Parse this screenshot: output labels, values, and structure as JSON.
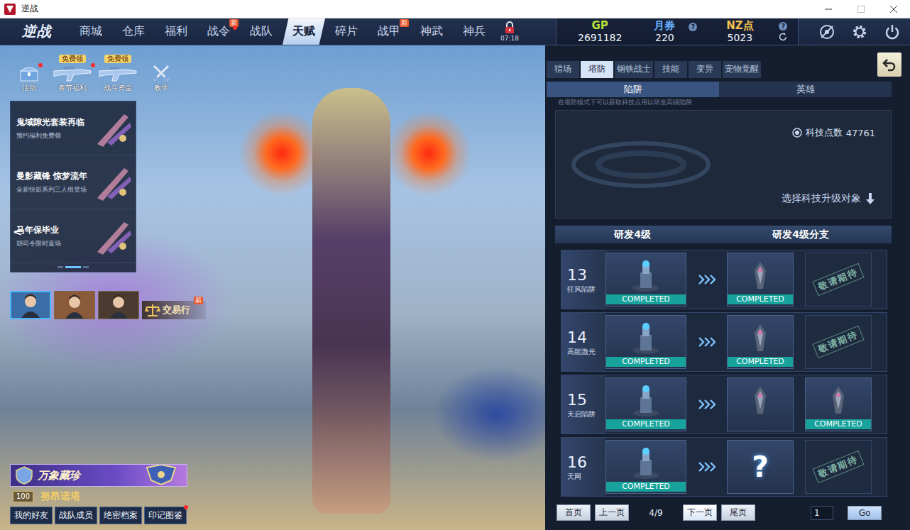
{
  "window": {
    "title": "逆战"
  },
  "nav": {
    "logo": "逆战",
    "lock_time": "07:18",
    "items": [
      {
        "label": "商城",
        "selected": false,
        "badge": "",
        "dot": false
      },
      {
        "label": "仓库",
        "selected": false,
        "badge": "",
        "dot": false
      },
      {
        "label": "福利",
        "selected": false,
        "badge": "",
        "dot": false
      },
      {
        "label": "战令",
        "selected": false,
        "badge": "新",
        "dot": true
      },
      {
        "label": "战队",
        "selected": false,
        "badge": "",
        "dot": false
      },
      {
        "label": "天赋",
        "selected": true,
        "badge": "",
        "dot": false
      },
      {
        "label": "碎片",
        "selected": false,
        "badge": "",
        "dot": false
      },
      {
        "label": "战甲",
        "selected": false,
        "badge": "新",
        "dot": false
      },
      {
        "label": "神武",
        "selected": false,
        "badge": "",
        "dot": false
      },
      {
        "label": "神兵",
        "selected": false,
        "badge": "",
        "dot": false
      }
    ]
  },
  "currencies": [
    {
      "label": "GP",
      "value": "2691182",
      "help": "",
      "refresh": false,
      "color": "#b5e03c"
    },
    {
      "label": "月券",
      "value": "220",
      "help": "?",
      "refresh": false,
      "color": "#6ab4ff"
    },
    {
      "label": "NZ点",
      "value": "5023",
      "help": "?",
      "refresh": true,
      "color": "#f2c14e"
    }
  ],
  "activities": [
    {
      "label": "活动",
      "badge": "",
      "dot": true,
      "kind": "chest"
    },
    {
      "label": "春节福利",
      "badge": "免费领",
      "dot": true,
      "kind": "gun"
    },
    {
      "label": "战斗资金",
      "badge": "免费领",
      "dot": false,
      "kind": "gun"
    },
    {
      "label": "教学",
      "badge": "",
      "dot": false,
      "kind": "swords"
    }
  ],
  "banners": [
    {
      "title": "鬼域隙光套装再临",
      "subtitle": "预约福利免费领"
    },
    {
      "title": "曼影藏锋 惊梦流年",
      "subtitle": "全新快影系列三人组登场"
    },
    {
      "title": "马年保毕业",
      "subtitle": "胡司令限时返场"
    }
  ],
  "carousel": {
    "prev": "<",
    "dots": [
      {
        "selected": false
      },
      {
        "selected": true
      },
      {
        "selected": false
      }
    ]
  },
  "avatars": [
    {
      "selected": true,
      "color": "#3b6ea6"
    },
    {
      "selected": false,
      "color": "#8a5a3a"
    },
    {
      "selected": false,
      "color": "#4a3a30"
    }
  ],
  "trade": {
    "label": "交易行",
    "badge": "新"
  },
  "promo": {
    "title": "万象藏珍"
  },
  "player": {
    "level": "100",
    "name": "努昂诺塔"
  },
  "bottom_buttons": [
    {
      "label": "我的好友",
      "dot": false
    },
    {
      "label": "战队成员",
      "dot": false
    },
    {
      "label": "绝密档案",
      "dot": false
    },
    {
      "label": "印记图鉴",
      "dot": true
    }
  ],
  "panel": {
    "tabs": [
      {
        "label": "猎场",
        "selected": false
      },
      {
        "label": "塔防",
        "selected": true
      },
      {
        "label": "钢铁战士",
        "selected": false
      },
      {
        "label": "技能",
        "selected": false
      },
      {
        "label": "变异",
        "selected": false
      },
      {
        "label": "宠物觉醒",
        "selected": false
      }
    ],
    "subtabs": [
      {
        "label": "陷阱",
        "selected": true
      },
      {
        "label": "英雄",
        "selected": false
      }
    ],
    "hint": "在塔防模式下可以获取科技点用以研发高级陷阱",
    "tech": {
      "label": "科技点数",
      "value": "47761"
    },
    "select_hint": "选择科技升级对象",
    "columns": [
      "研发4级",
      "研发4级分支"
    ],
    "completed_label": "COMPLETED",
    "rows": [
      {
        "number": "13",
        "name": "狂风陷阱",
        "main": {
          "completed": true
        },
        "branches": [
          {
            "kind": "item",
            "completed": true,
            "label": ""
          },
          {
            "kind": "coming",
            "completed": false,
            "label": "敬请期待"
          }
        ]
      },
      {
        "number": "14",
        "name": "高能激光",
        "main": {
          "completed": true
        },
        "branches": [
          {
            "kind": "item",
            "completed": true,
            "label": ""
          },
          {
            "kind": "coming",
            "completed": false,
            "label": "敬请期待"
          }
        ]
      },
      {
        "number": "15",
        "name": "天启陷阱",
        "main": {
          "completed": true
        },
        "branches": [
          {
            "kind": "item",
            "completed": false,
            "label": ""
          },
          {
            "kind": "item",
            "completed": true,
            "label": ""
          }
        ]
      },
      {
        "number": "16",
        "name": "天网",
        "main": {
          "completed": true
        },
        "branches": [
          {
            "kind": "unknown",
            "completed": false,
            "label": "?"
          },
          {
            "kind": "coming",
            "completed": false,
            "label": "敬请期待"
          }
        ]
      }
    ]
  },
  "pagination": {
    "first": "首页",
    "prev": "上一页",
    "page": "4/9",
    "next": "下一页",
    "last": "尾页",
    "input": "1",
    "go": "Go"
  }
}
